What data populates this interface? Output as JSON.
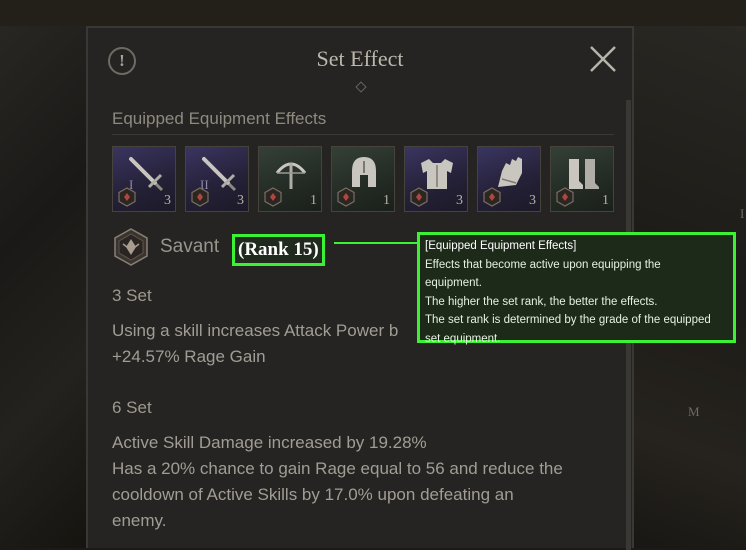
{
  "panel": {
    "title": "Set Effect",
    "info_icon_text": "!",
    "section_title": "Equipped Equipment Effects"
  },
  "items": [
    {
      "name": "sword-icon",
      "tier": "I",
      "count": "3",
      "rarity": "blue"
    },
    {
      "name": "sword-icon",
      "tier": "II",
      "count": "3",
      "rarity": "blue"
    },
    {
      "name": "crossbow-icon",
      "tier": "",
      "count": "1",
      "rarity": "green"
    },
    {
      "name": "helmet-icon",
      "tier": "",
      "count": "1",
      "rarity": "green"
    },
    {
      "name": "armor-icon",
      "tier": "",
      "count": "3",
      "rarity": "blue"
    },
    {
      "name": "gauntlet-icon",
      "tier": "",
      "count": "3",
      "rarity": "blue"
    },
    {
      "name": "boots-icon",
      "tier": "",
      "count": "1",
      "rarity": "green"
    }
  ],
  "set": {
    "name": "Savant",
    "rank": "(Rank 15)"
  },
  "sets": [
    {
      "label": "3 Set",
      "lines": [
        "Using a skill increases Attack Power b",
        "+24.57% Rage Gain"
      ]
    },
    {
      "label": "6 Set",
      "lines": [
        "Active Skill Damage increased by 19.28%",
        "Has a 20% chance to gain Rage equal to 56 and reduce the",
        "cooldown of Active Skills by 17.0% upon defeating an",
        "enemy."
      ]
    }
  ],
  "tooltip": {
    "title": "[Equipped Equipment Effects]",
    "lines": [
      "Effects that become active upon equipping the",
      "equipment.",
      "The higher the set rank, the better the effects.",
      "The set rank is determined by the grade of the equipped",
      "set equipment."
    ]
  },
  "background": {
    "right_letter_1": "I",
    "right_letter_2": "M"
  },
  "colors": {
    "highlight": "#3cf033",
    "panel_bg": "#252422",
    "rare_blue": "#3a3560",
    "uncommon_green": "#344036"
  }
}
